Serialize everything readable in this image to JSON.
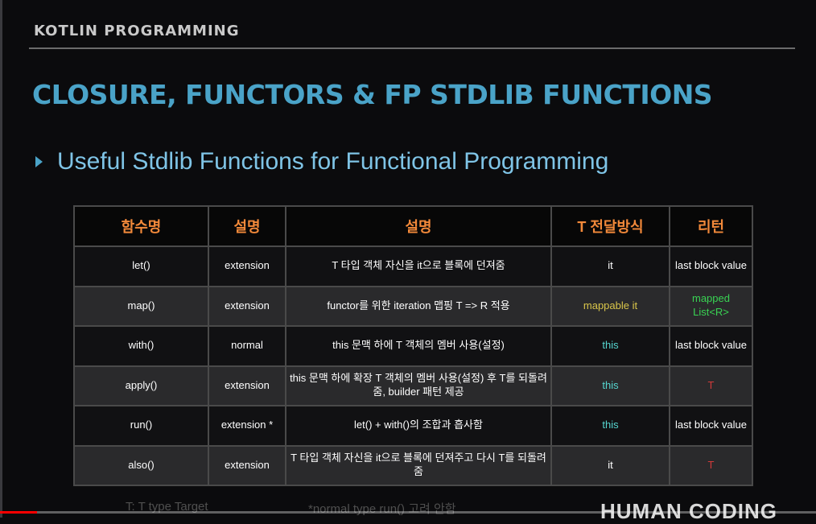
{
  "slide": {
    "course": "KOTLIN PROGRAMMING",
    "title": "CLOSURE, FUNCTORS & FP STDLIB FUNCTIONS",
    "bullet": "Useful Stdlib Functions for Functional Programming"
  },
  "colors": {
    "title": "#4aa3c8",
    "header_text": "#f2893a",
    "green": "#39d353",
    "cyan": "#55d6d0",
    "yellow": "#d9c54a",
    "red": "#d23a3a"
  },
  "table": {
    "headers": [
      "함수명",
      "설명",
      "설명",
      "T 전달방식",
      "리턴"
    ],
    "rows": [
      {
        "name": "let()",
        "type": "extension",
        "desc": "T 타입 객체 자신을 it으로 블록에 던져줌",
        "passing": "it",
        "passing_color": "white",
        "ret": "last block value",
        "ret_color": "white"
      },
      {
        "name": "map()",
        "type": "extension",
        "desc": "functor를 위한 iteration 맵핑 T => R 적용",
        "passing": "mappable it",
        "passing_color": "yellow",
        "ret": "mapped List<R>",
        "ret_color": "green"
      },
      {
        "name": "with()",
        "type": "normal",
        "desc": "this 문맥 하에 T 객체의 멤버 사용(설정)",
        "passing": "this",
        "passing_color": "cyan",
        "ret": "last block value",
        "ret_color": "white"
      },
      {
        "name": "apply()",
        "type": "extension",
        "desc": "this 문맥 하에 확장 T 객체의 멤버 사용(설정) 후 T를 되돌려줌, builder 패턴 제공",
        "passing": "this",
        "passing_color": "cyan",
        "ret": "T",
        "ret_color": "red"
      },
      {
        "name": "run()",
        "type": "extension *",
        "desc": "let() + with()의 조합과 흡사함",
        "passing": "this",
        "passing_color": "cyan",
        "ret": "last block value",
        "ret_color": "white"
      },
      {
        "name": "also()",
        "type": "extension",
        "desc": "T 타입 객체 자신을 it으로 블록에 던져주고 다시 T를 되돌려줌",
        "passing": "it",
        "passing_color": "white",
        "ret": "T",
        "ret_color": "red"
      }
    ]
  },
  "footnotes": {
    "left": "T: T type Target",
    "right": "*normal type run() 고려 안함"
  },
  "brand": "HUMAN CODING",
  "video": {
    "progress": 0.045
  }
}
